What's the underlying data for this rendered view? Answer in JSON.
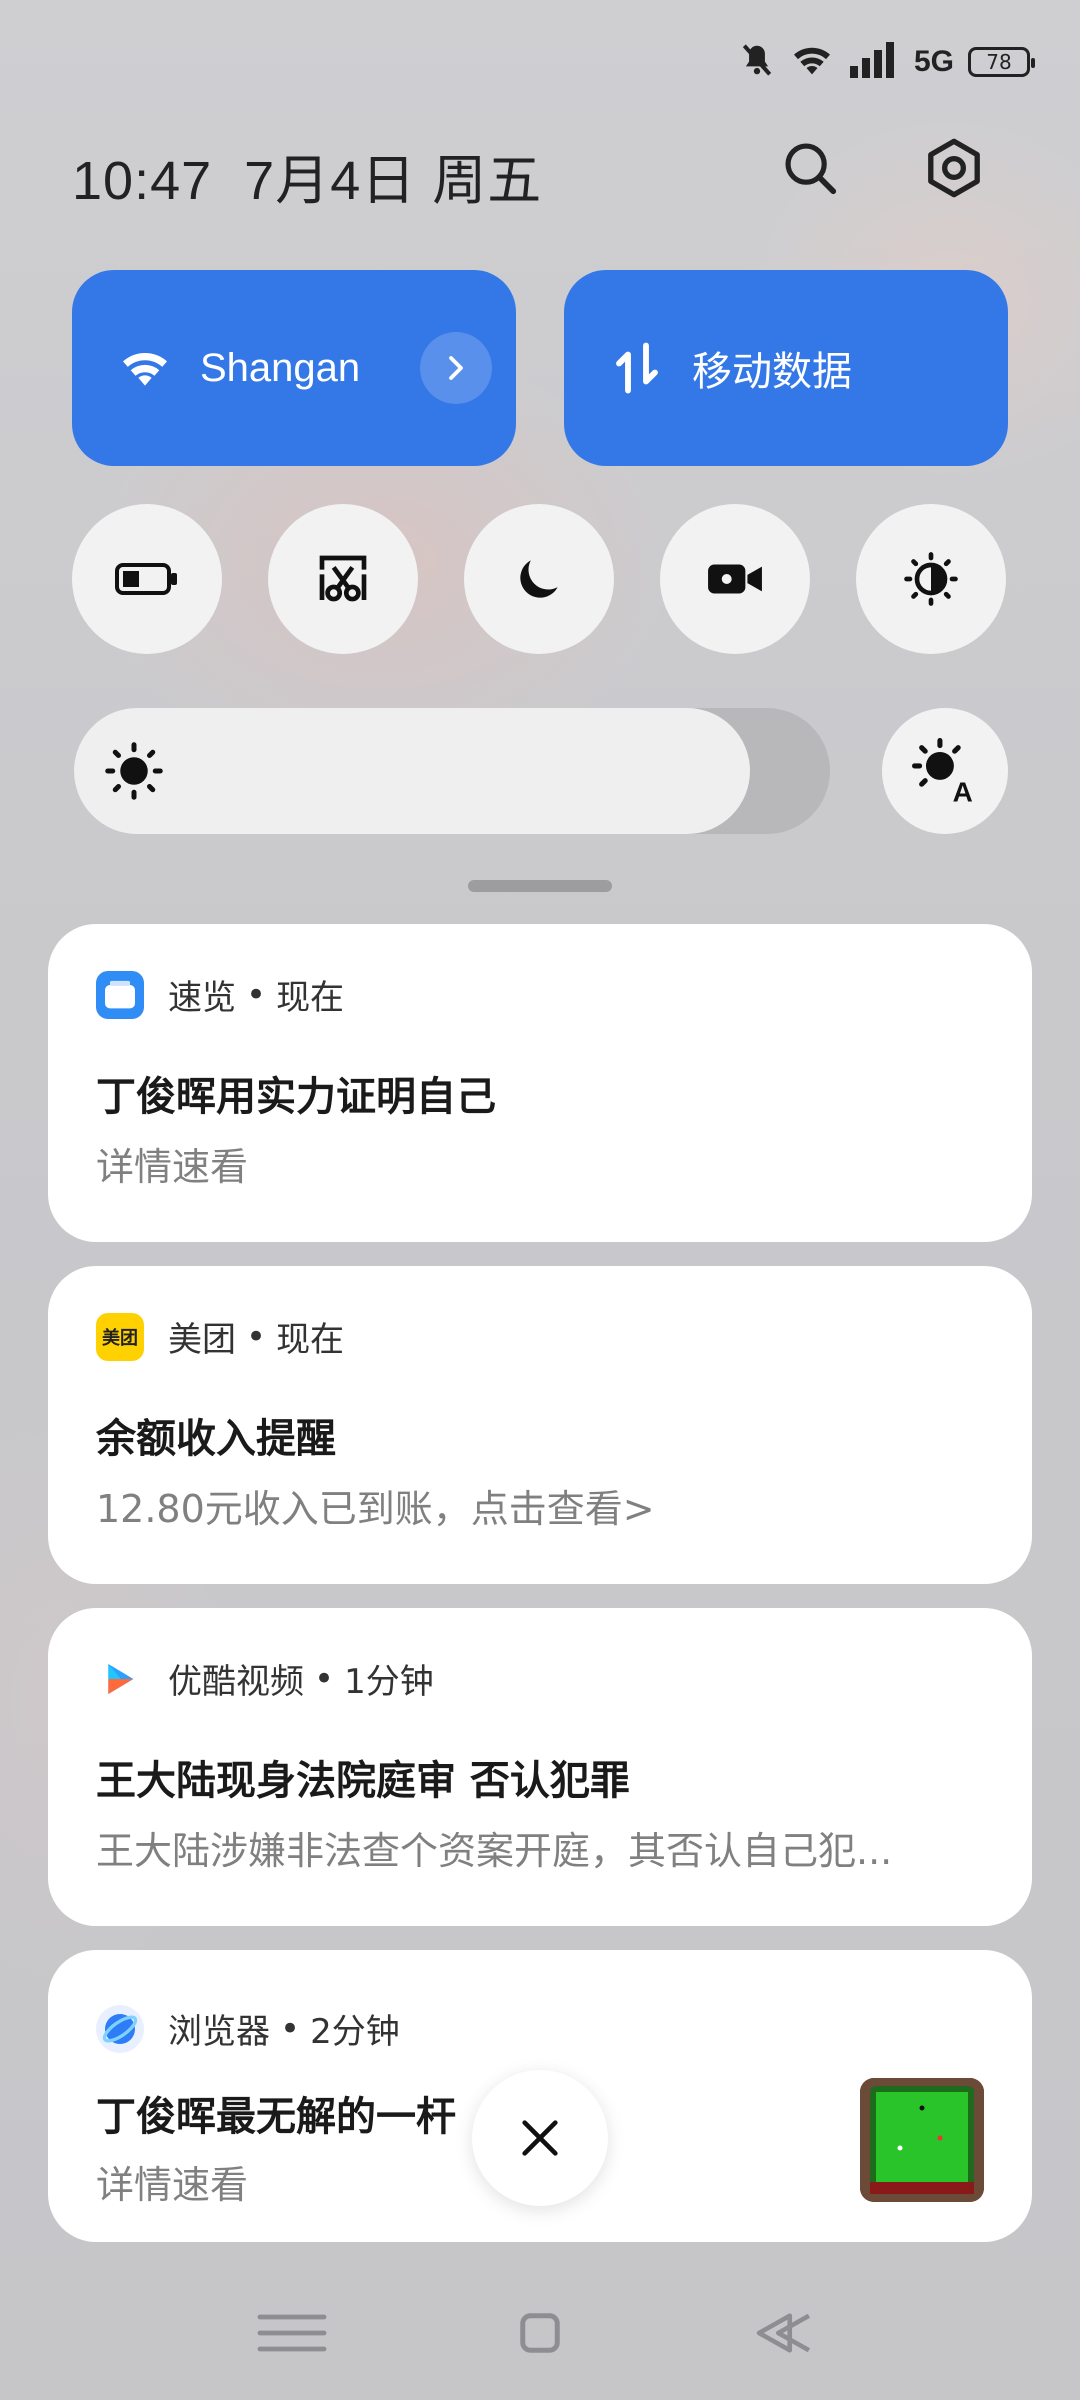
{
  "status_bar": {
    "network": "5G",
    "battery": "78"
  },
  "header": {
    "time": "10:47",
    "date": "7月4日 周五"
  },
  "tiles": {
    "wifi": {
      "label": "Shangan"
    },
    "mobile": {
      "label": "移动数据"
    }
  },
  "accent_color": "#3478e8",
  "notifications": [
    {
      "app": "速览",
      "time": "现在",
      "title": "丁俊晖用实力证明自己",
      "body": "详情速看"
    },
    {
      "app": "美团",
      "icon_text": "美团",
      "time": "现在",
      "title": "余额收入提醒",
      "body": "12.80元收入已到账，点击查看>"
    },
    {
      "app": "优酷视频",
      "time": "1分钟",
      "title": "王大陆现身法院庭审 否认犯罪",
      "body": "王大陆涉嫌非法查个资案开庭，其否认自己犯..."
    },
    {
      "app": "浏览器",
      "time": "2分钟",
      "title": "丁俊晖最无解的一杆",
      "body": "详情速看"
    }
  ]
}
